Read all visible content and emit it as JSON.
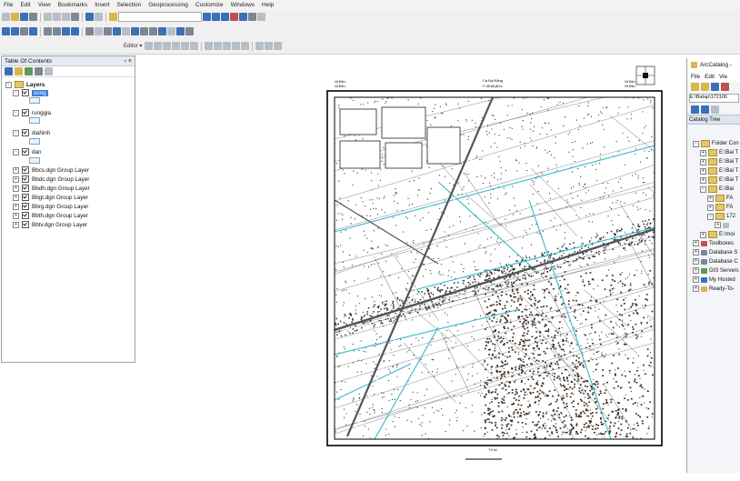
{
  "menu": [
    "File",
    "Edit",
    "View",
    "Bookmarks",
    "Insert",
    "Selection",
    "Geoprocessing",
    "Customize",
    "Windows",
    "Help"
  ],
  "toolbar": {
    "editor_label": "Editor ▾"
  },
  "toc": {
    "title": "Table Of Contents",
    "root": "Layers",
    "layers": [
      {
        "name": "song",
        "selected": true,
        "symbol": true
      },
      {
        "name": "runggia",
        "selected": false,
        "symbol": true
      },
      {
        "name": "diahinh",
        "selected": false,
        "symbol": true
      },
      {
        "name": "dan",
        "selected": false,
        "symbol": true
      },
      {
        "name": "Bbcs.dgn Group Layer",
        "selected": false,
        "symbol": false
      },
      {
        "name": "Bbdc.dgn Group Layer",
        "selected": false,
        "symbol": false
      },
      {
        "name": "Bbdh.dgn Group Layer",
        "selected": false,
        "symbol": false
      },
      {
        "name": "Bbgt.dgn Group Layer",
        "selected": false,
        "symbol": false
      },
      {
        "name": "Bbrg.dgn Group Layer",
        "selected": false,
        "symbol": false
      },
      {
        "name": "Bbth.dgn Group Layer",
        "selected": false,
        "symbol": false
      },
      {
        "name": "Bbtv.dgn Group Layer",
        "selected": false,
        "symbol": false
      }
    ]
  },
  "catalog": {
    "title": "ArcCatalog -",
    "menu": [
      "File",
      "Edit",
      "Vie"
    ],
    "address": "E:\\Batap\\172106",
    "tree_header": "Catalog Tree",
    "items": [
      "Folder Con",
      "E:\\Bai T",
      "E:\\Bai T",
      "E:\\Bai T",
      "E:\\Bai T",
      "E:\\Bai",
      "FA",
      "FA",
      "172",
      "",
      "E:\\moi",
      "Toolboxes",
      "Database S",
      "Database C",
      "GIS Servers",
      "My Hosted",
      "Ready-To-"
    ]
  },
  "map": {
    "header_line1": "Ca Đà Nẵng",
    "header_line2": "F-48-68-(B-b)",
    "corner_text_left1": "Xã Điện...",
    "corner_text_left2": "Xã Điện...",
    "corner_text_right1": "Xã Điện...",
    "corner_text_right2": "Xã Điện...",
    "footer_text": "Tờ số",
    "colors": {
      "water": "#38b8cc",
      "road": "#555555",
      "settlement": "#3a2a1e",
      "frame": "#000000"
    }
  },
  "colors": {
    "accent": "#3c7fd6",
    "toolbar_bg": "#f0f0f0"
  }
}
